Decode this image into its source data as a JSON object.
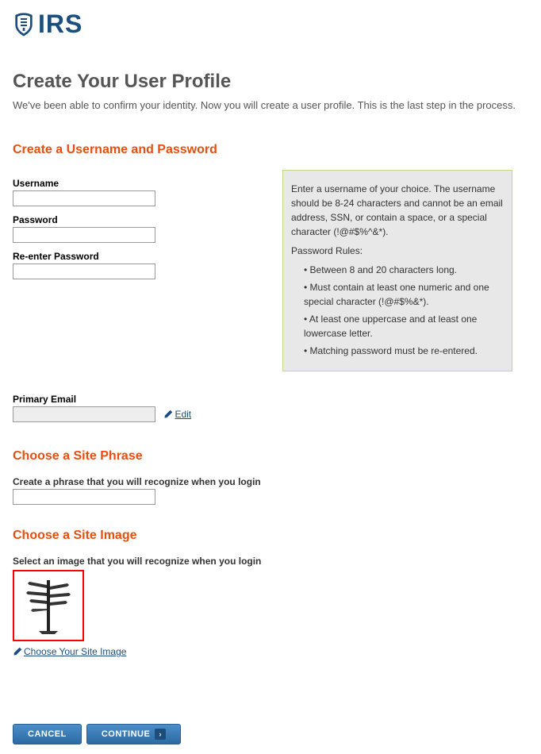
{
  "logo_text": "IRS",
  "page_title": "Create Your User Profile",
  "intro": "We've been able to confirm your identity. Now you will create a user profile. This is the last step in the process.",
  "section_credentials": "Create a Username and Password",
  "labels": {
    "username": "Username",
    "password": "Password",
    "reenter": "Re-enter Password",
    "primary_email": "Primary Email"
  },
  "values": {
    "username": "",
    "password": "",
    "reenter": "",
    "primary_email": ""
  },
  "edit_text": " Edit",
  "infobox": {
    "username_note": "Enter a username of your choice. The username should be 8-24 characters and cannot be an email address, SSN, or contain a space, or a special character (!@#$%^&*).",
    "rules_header": "Password Rules:",
    "rules": [
      "Between 8 and 20 characters long.",
      "Must contain at least one numeric and one special character (!@#$%&*).",
      "At least one uppercase and at least one lowercase letter.",
      "Matching password must be re-entered."
    ]
  },
  "section_phrase": "Choose a Site Phrase",
  "phrase_instruction": "Create a phrase that you will recognize when you login",
  "values_phrase": "",
  "section_image": "Choose a Site Image",
  "image_instruction": "Select an image that you will recognize when you login",
  "choose_image_text": " Choose Your Site Image",
  "buttons": {
    "cancel": "CANCEL",
    "continue": "CONTINUE"
  }
}
